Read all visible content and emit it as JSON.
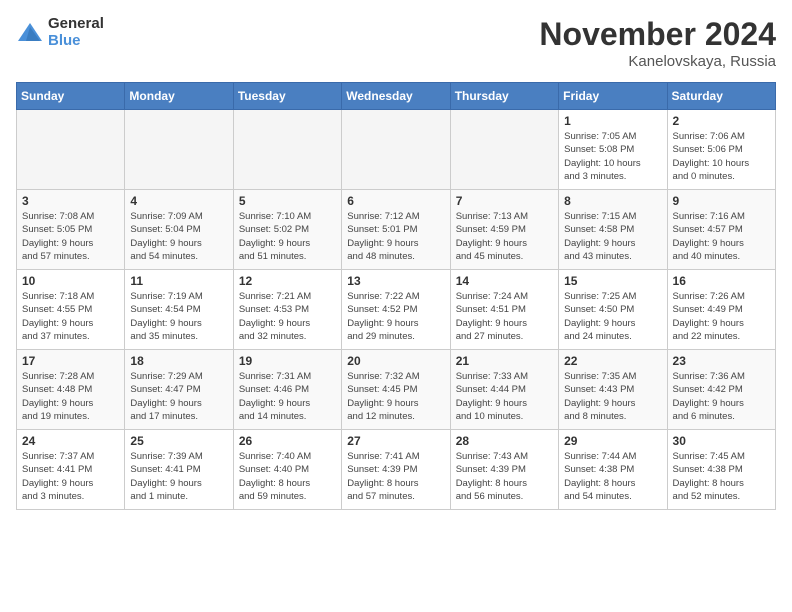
{
  "header": {
    "logo_general": "General",
    "logo_blue": "Blue",
    "month_title": "November 2024",
    "location": "Kanelovskaya, Russia"
  },
  "days_of_week": [
    "Sunday",
    "Monday",
    "Tuesday",
    "Wednesday",
    "Thursday",
    "Friday",
    "Saturday"
  ],
  "weeks": [
    [
      {
        "day": "",
        "info": ""
      },
      {
        "day": "",
        "info": ""
      },
      {
        "day": "",
        "info": ""
      },
      {
        "day": "",
        "info": ""
      },
      {
        "day": "",
        "info": ""
      },
      {
        "day": "1",
        "info": "Sunrise: 7:05 AM\nSunset: 5:08 PM\nDaylight: 10 hours\nand 3 minutes."
      },
      {
        "day": "2",
        "info": "Sunrise: 7:06 AM\nSunset: 5:06 PM\nDaylight: 10 hours\nand 0 minutes."
      }
    ],
    [
      {
        "day": "3",
        "info": "Sunrise: 7:08 AM\nSunset: 5:05 PM\nDaylight: 9 hours\nand 57 minutes."
      },
      {
        "day": "4",
        "info": "Sunrise: 7:09 AM\nSunset: 5:04 PM\nDaylight: 9 hours\nand 54 minutes."
      },
      {
        "day": "5",
        "info": "Sunrise: 7:10 AM\nSunset: 5:02 PM\nDaylight: 9 hours\nand 51 minutes."
      },
      {
        "day": "6",
        "info": "Sunrise: 7:12 AM\nSunset: 5:01 PM\nDaylight: 9 hours\nand 48 minutes."
      },
      {
        "day": "7",
        "info": "Sunrise: 7:13 AM\nSunset: 4:59 PM\nDaylight: 9 hours\nand 45 minutes."
      },
      {
        "day": "8",
        "info": "Sunrise: 7:15 AM\nSunset: 4:58 PM\nDaylight: 9 hours\nand 43 minutes."
      },
      {
        "day": "9",
        "info": "Sunrise: 7:16 AM\nSunset: 4:57 PM\nDaylight: 9 hours\nand 40 minutes."
      }
    ],
    [
      {
        "day": "10",
        "info": "Sunrise: 7:18 AM\nSunset: 4:55 PM\nDaylight: 9 hours\nand 37 minutes."
      },
      {
        "day": "11",
        "info": "Sunrise: 7:19 AM\nSunset: 4:54 PM\nDaylight: 9 hours\nand 35 minutes."
      },
      {
        "day": "12",
        "info": "Sunrise: 7:21 AM\nSunset: 4:53 PM\nDaylight: 9 hours\nand 32 minutes."
      },
      {
        "day": "13",
        "info": "Sunrise: 7:22 AM\nSunset: 4:52 PM\nDaylight: 9 hours\nand 29 minutes."
      },
      {
        "day": "14",
        "info": "Sunrise: 7:24 AM\nSunset: 4:51 PM\nDaylight: 9 hours\nand 27 minutes."
      },
      {
        "day": "15",
        "info": "Sunrise: 7:25 AM\nSunset: 4:50 PM\nDaylight: 9 hours\nand 24 minutes."
      },
      {
        "day": "16",
        "info": "Sunrise: 7:26 AM\nSunset: 4:49 PM\nDaylight: 9 hours\nand 22 minutes."
      }
    ],
    [
      {
        "day": "17",
        "info": "Sunrise: 7:28 AM\nSunset: 4:48 PM\nDaylight: 9 hours\nand 19 minutes."
      },
      {
        "day": "18",
        "info": "Sunrise: 7:29 AM\nSunset: 4:47 PM\nDaylight: 9 hours\nand 17 minutes."
      },
      {
        "day": "19",
        "info": "Sunrise: 7:31 AM\nSunset: 4:46 PM\nDaylight: 9 hours\nand 14 minutes."
      },
      {
        "day": "20",
        "info": "Sunrise: 7:32 AM\nSunset: 4:45 PM\nDaylight: 9 hours\nand 12 minutes."
      },
      {
        "day": "21",
        "info": "Sunrise: 7:33 AM\nSunset: 4:44 PM\nDaylight: 9 hours\nand 10 minutes."
      },
      {
        "day": "22",
        "info": "Sunrise: 7:35 AM\nSunset: 4:43 PM\nDaylight: 9 hours\nand 8 minutes."
      },
      {
        "day": "23",
        "info": "Sunrise: 7:36 AM\nSunset: 4:42 PM\nDaylight: 9 hours\nand 6 minutes."
      }
    ],
    [
      {
        "day": "24",
        "info": "Sunrise: 7:37 AM\nSunset: 4:41 PM\nDaylight: 9 hours\nand 3 minutes."
      },
      {
        "day": "25",
        "info": "Sunrise: 7:39 AM\nSunset: 4:41 PM\nDaylight: 9 hours\nand 1 minute."
      },
      {
        "day": "26",
        "info": "Sunrise: 7:40 AM\nSunset: 4:40 PM\nDaylight: 8 hours\nand 59 minutes."
      },
      {
        "day": "27",
        "info": "Sunrise: 7:41 AM\nSunset: 4:39 PM\nDaylight: 8 hours\nand 57 minutes."
      },
      {
        "day": "28",
        "info": "Sunrise: 7:43 AM\nSunset: 4:39 PM\nDaylight: 8 hours\nand 56 minutes."
      },
      {
        "day": "29",
        "info": "Sunrise: 7:44 AM\nSunset: 4:38 PM\nDaylight: 8 hours\nand 54 minutes."
      },
      {
        "day": "30",
        "info": "Sunrise: 7:45 AM\nSunset: 4:38 PM\nDaylight: 8 hours\nand 52 minutes."
      }
    ]
  ]
}
